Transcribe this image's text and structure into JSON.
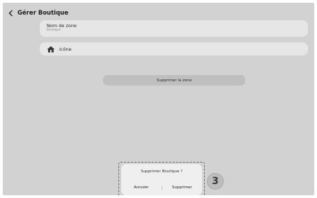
{
  "header": {
    "back_icon": "chevron-left-icon",
    "title": "Gérer Boutique"
  },
  "zone_name": {
    "label": "Nom de zone",
    "value": "Boutique"
  },
  "zone_icon": {
    "icon": "home-icon",
    "label": "Icône"
  },
  "delete_zone_label": "Supprimer la zone",
  "dialog": {
    "message": "Supprimer Boutique ?",
    "cancel_label": "Annuler",
    "confirm_label": "Supprimer"
  },
  "step_badge": "3",
  "colors": {
    "background": "#d2d2d2",
    "card": "#e6e6e6",
    "button": "#bfbfbf",
    "dialog": "#efefef"
  }
}
